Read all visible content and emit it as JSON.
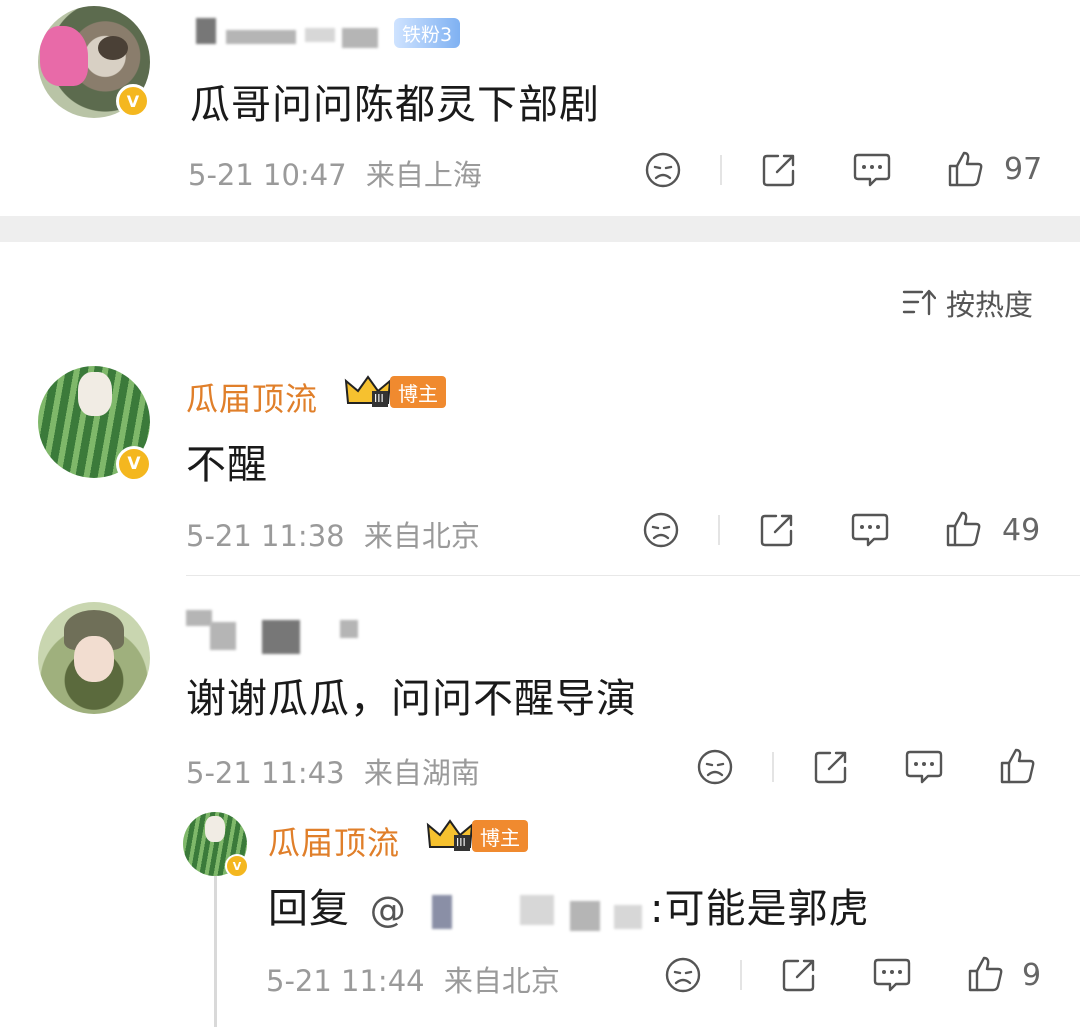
{
  "sort": {
    "label": "按热度"
  },
  "comments": [
    {
      "fan_badge": "铁粉3",
      "text": "瓜哥问问陈都灵下部剧",
      "time": "5-21 10:47",
      "location": "来自上海",
      "likes": "97"
    },
    {
      "username": "瓜届顶流",
      "role_badge": "博主",
      "crown_level": "III",
      "text": "不醒",
      "time": "5-21 11:38",
      "location": "来自北京",
      "likes": "49"
    },
    {
      "text": "谢谢瓜瓜，问问不醒导演",
      "time": "5-21 11:43",
      "location": "来自湖南",
      "likes": ""
    }
  ],
  "reply": {
    "username": "瓜届顶流",
    "role_badge": "博主",
    "crown_level": "III",
    "prefix": "回复",
    "at_symbol": "@",
    "text": ":可能是郭虎",
    "time": "5-21 11:44",
    "location": "来自北京",
    "likes": "9"
  },
  "colors": {
    "username": "#e07f2a",
    "meta": "#9a9a9a",
    "vip_badge": "#f4b71f",
    "role_badge": "#f08a2f"
  },
  "icons": [
    "dislike-face-icon",
    "share-icon",
    "comment-icon",
    "like-thumb-icon",
    "sort-icon",
    "verified-v-icon",
    "crown-icon"
  ]
}
